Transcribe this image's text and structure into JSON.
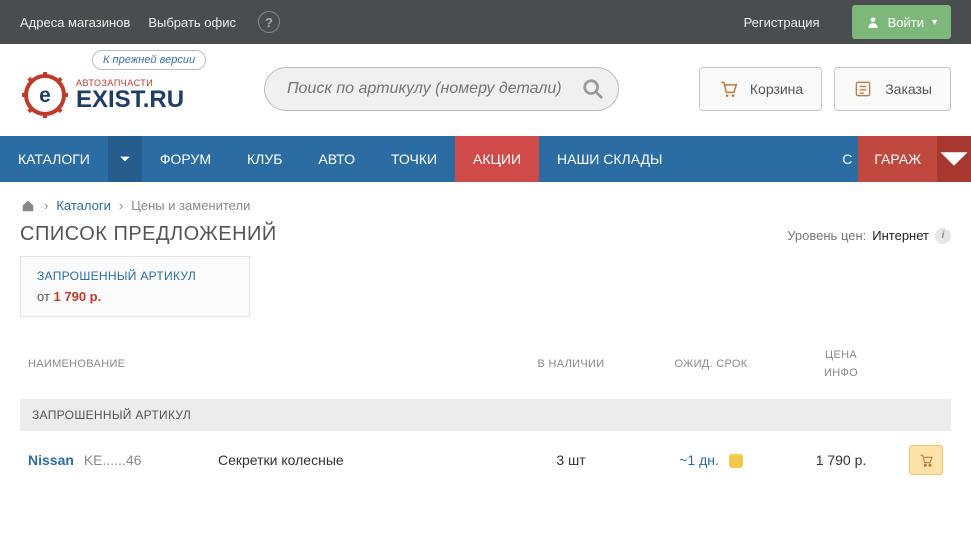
{
  "topbar": {
    "stores": "Адреса магазинов",
    "choose_office": "Выбрать офис",
    "help": "?",
    "register": "Регистрация",
    "login": "Войти"
  },
  "header": {
    "old_version": "К прежней версии",
    "logo_sub": "АВТОЗАПЧАСТИ",
    "logo_main": "EXIST.RU",
    "search_placeholder": "Поиск по артикулу (номеру детали)",
    "cart": "Корзина",
    "orders": "Заказы"
  },
  "nav": {
    "catalogs": "КАТАЛОГИ",
    "forum": "ФОРУМ",
    "club": "КЛУБ",
    "auto": "АВТО",
    "points": "ТОЧКИ",
    "promo": "АКЦИИ",
    "warehouses": "НАШИ СКЛАДЫ",
    "truncated": "С",
    "garage": "ГАРАЖ"
  },
  "breadcrumb": {
    "catalogs": "Каталоги",
    "current": "Цены и заменители"
  },
  "page": {
    "title": "СПИСОК ПРЕДЛОЖЕНИЙ",
    "price_level_label": "Уровень цен:",
    "price_level_value": "Интернет"
  },
  "requested_box": {
    "title": "ЗАПРОШЕННЫЙ АРТИКУЛ",
    "from": "от",
    "price": "1 790 р."
  },
  "table": {
    "headers": {
      "name": "НАИМЕНОВАНИЕ",
      "stock": "В НАЛИЧИИ",
      "wait": "ОЖИД. СРОК",
      "price": "ЦЕНА",
      "info": "ИНФО"
    },
    "section": "ЗАПРОШЕННЫЙ АРТИКУЛ",
    "rows": [
      {
        "brand": "Nissan",
        "article": "KE......46",
        "desc": "Секретки колесные",
        "stock": "3 шт",
        "wait": "~1 дн.",
        "price": "1 790 р."
      }
    ]
  }
}
